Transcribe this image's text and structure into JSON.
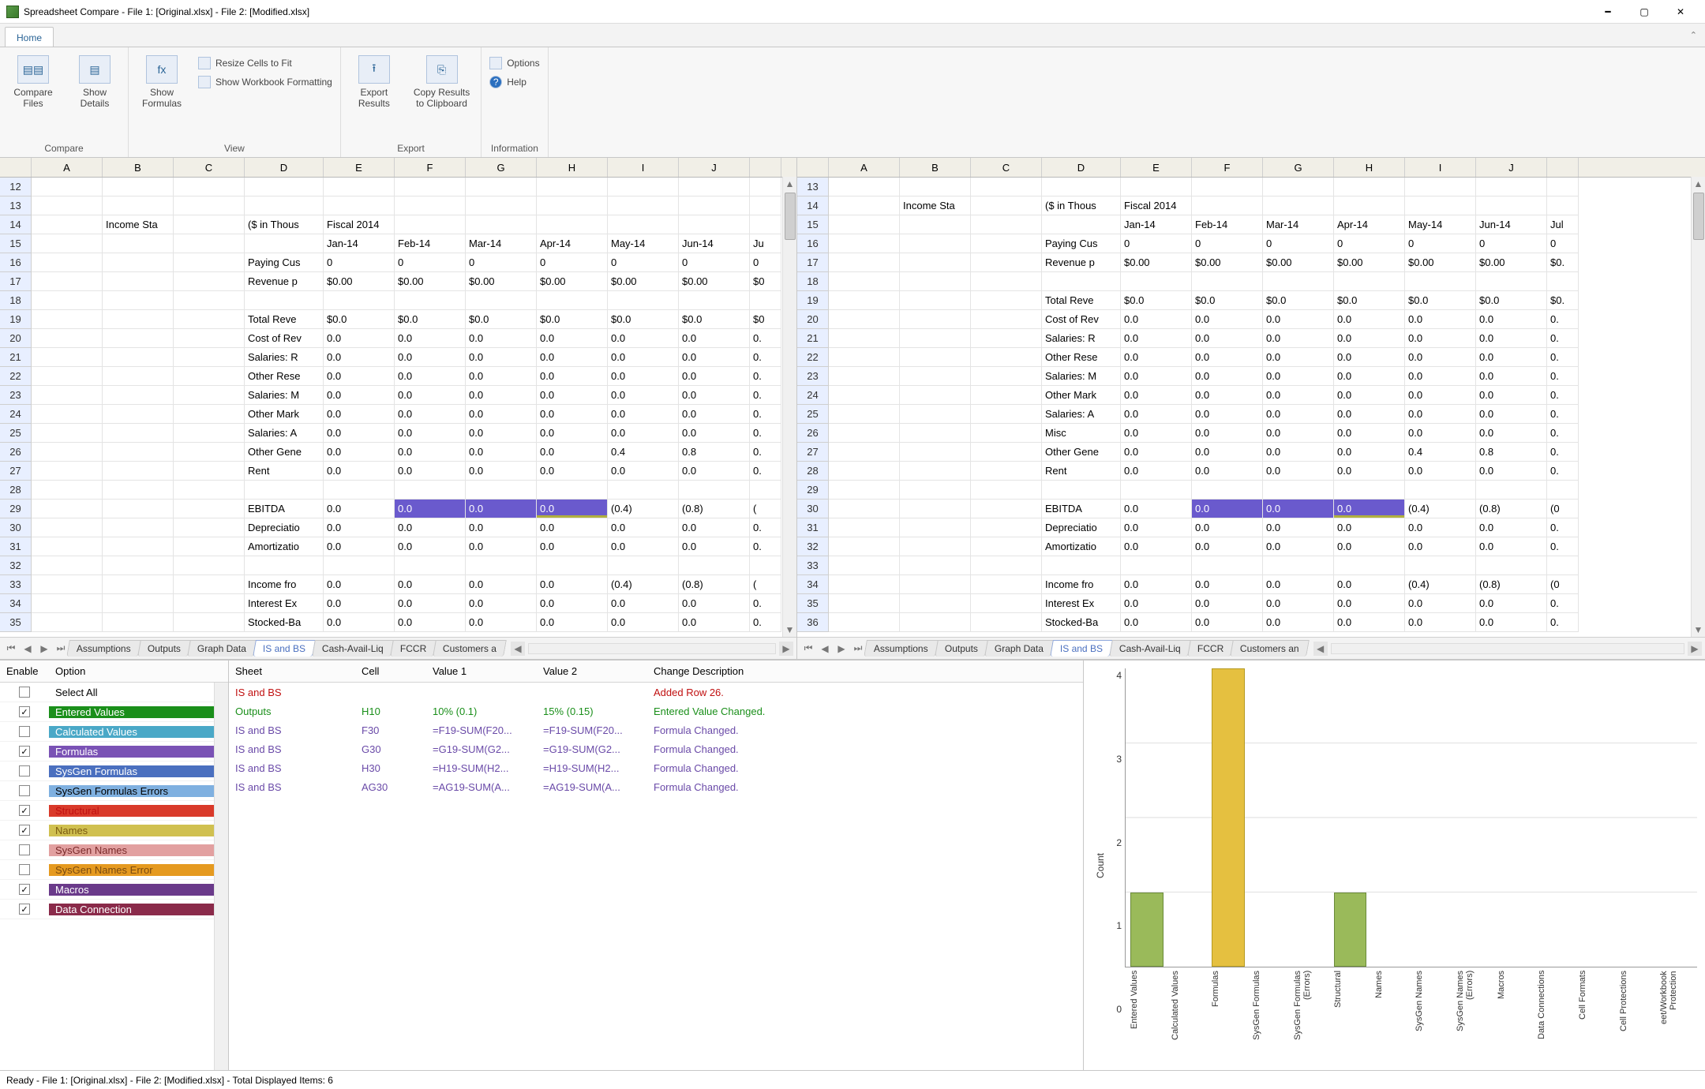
{
  "window": {
    "title": "Spreadsheet Compare - File 1: [Original.xlsx] - File 2: [Modified.xlsx]"
  },
  "tab": {
    "home": "Home"
  },
  "ribbon": {
    "compare": {
      "compareFiles": "Compare\nFiles",
      "showDetails": "Show\nDetails",
      "group": "Compare"
    },
    "view": {
      "showFormulas": "Show\nFormulas",
      "resize": "Resize Cells to Fit",
      "showWb": "Show Workbook Formatting",
      "group": "View"
    },
    "export": {
      "exportResults": "Export\nResults",
      "copyResults": "Copy Results\nto Clipboard",
      "group": "Export"
    },
    "info": {
      "options": "Options",
      "help": "Help",
      "group": "Information"
    }
  },
  "grid": {
    "cols": [
      "A",
      "B",
      "C",
      "D",
      "E",
      "F",
      "G",
      "H",
      "I",
      "J"
    ],
    "colsR": [
      "A",
      "B",
      "C",
      "D",
      "E",
      "F",
      "G",
      "H",
      "I",
      "J"
    ],
    "rowsLeft": [
      12,
      13,
      14,
      15,
      16,
      17,
      18,
      19,
      20,
      21,
      22,
      23,
      24,
      25,
      26,
      27,
      28,
      29,
      30,
      31,
      32,
      33,
      34,
      35
    ],
    "rowsRight": [
      13,
      14,
      15,
      16,
      17,
      18,
      19,
      20,
      21,
      22,
      23,
      24,
      25,
      26,
      27,
      28,
      29,
      30,
      31,
      32,
      33,
      34,
      35,
      36
    ],
    "left": {
      "14": {
        "B": "Income Sta",
        "D": "($ in Thous",
        "E": "Fiscal 2014"
      },
      "15": {
        "E": "Jan-14",
        "F": "Feb-14",
        "G": "Mar-14",
        "H": "Apr-14",
        "I": "May-14",
        "J": "Jun-14",
        "K": "Ju"
      },
      "16": {
        "D": "Paying Cus",
        "E": "0",
        "F": "0",
        "G": "0",
        "H": "0",
        "I": "0",
        "J": "0",
        "K": "0"
      },
      "17": {
        "D": "Revenue p",
        "E": "$0.00",
        "F": "$0.00",
        "G": "$0.00",
        "H": "$0.00",
        "I": "$0.00",
        "J": "$0.00",
        "K": "$0"
      },
      "19": {
        "D": "Total Reve",
        "E": "$0.0",
        "F": "$0.0",
        "G": "$0.0",
        "H": "$0.0",
        "I": "$0.0",
        "J": "$0.0",
        "K": "$0"
      },
      "20": {
        "D": "Cost of Rev",
        "E": "0.0",
        "F": "0.0",
        "G": "0.0",
        "H": "0.0",
        "I": "0.0",
        "J": "0.0",
        "K": "0."
      },
      "21": {
        "D": "Salaries: R",
        "E": "0.0",
        "F": "0.0",
        "G": "0.0",
        "H": "0.0",
        "I": "0.0",
        "J": "0.0",
        "K": "0."
      },
      "22": {
        "D": "Other Rese",
        "E": "0.0",
        "F": "0.0",
        "G": "0.0",
        "H": "0.0",
        "I": "0.0",
        "J": "0.0",
        "K": "0."
      },
      "23": {
        "D": "Salaries: M",
        "E": "0.0",
        "F": "0.0",
        "G": "0.0",
        "H": "0.0",
        "I": "0.0",
        "J": "0.0",
        "K": "0."
      },
      "24": {
        "D": "Other Mark",
        "E": "0.0",
        "F": "0.0",
        "G": "0.0",
        "H": "0.0",
        "I": "0.0",
        "J": "0.0",
        "K": "0."
      },
      "25": {
        "D": "Salaries: A",
        "E": "0.0",
        "F": "0.0",
        "G": "0.0",
        "H": "0.0",
        "I": "0.0",
        "J": "0.0",
        "K": "0."
      },
      "26": {
        "D": "Other Gene",
        "E": "0.0",
        "F": "0.0",
        "G": "0.0",
        "H": "0.0",
        "I": "0.4",
        "J": "0.8",
        "K": "0."
      },
      "27": {
        "D": "Rent",
        "E": "0.0",
        "F": "0.0",
        "G": "0.0",
        "H": "0.0",
        "I": "0.0",
        "J": "0.0",
        "K": "0."
      },
      "29": {
        "D": "EBITDA",
        "E": "0.0",
        "F": "0.0",
        "G": "0.0",
        "H": "0.0",
        "I": "(0.4)",
        "J": "(0.8)",
        "K": "("
      },
      "30": {
        "D": "Depreciatio",
        "E": "0.0",
        "F": "0.0",
        "G": "0.0",
        "H": "0.0",
        "I": "0.0",
        "J": "0.0",
        "K": "0."
      },
      "31": {
        "D": "Amortizatio",
        "E": "0.0",
        "F": "0.0",
        "G": "0.0",
        "H": "0.0",
        "I": "0.0",
        "J": "0.0",
        "K": "0."
      },
      "33": {
        "D": "Income fro",
        "E": "0.0",
        "F": "0.0",
        "G": "0.0",
        "H": "0.0",
        "I": "(0.4)",
        "J": "(0.8)",
        "K": "("
      },
      "34": {
        "D": "Interest Ex",
        "E": "0.0",
        "F": "0.0",
        "G": "0.0",
        "H": "0.0",
        "I": "0.0",
        "J": "0.0",
        "K": "0."
      },
      "35": {
        "D": "Stocked-Ba",
        "E": "0.0",
        "F": "0.0",
        "G": "0.0",
        "H": "0.0",
        "I": "0.0",
        "J": "0.0",
        "K": "0."
      }
    },
    "right": {
      "14": {
        "B": "Income Sta",
        "D": "($ in Thous",
        "E": "Fiscal 2014"
      },
      "15": {
        "E": "Jan-14",
        "F": "Feb-14",
        "G": "Mar-14",
        "H": "Apr-14",
        "I": "May-14",
        "J": "Jun-14",
        "K": "Jul"
      },
      "16": {
        "D": "Paying Cus",
        "E": "0",
        "F": "0",
        "G": "0",
        "H": "0",
        "I": "0",
        "J": "0",
        "K": "0"
      },
      "17": {
        "D": "Revenue p",
        "E": "$0.00",
        "F": "$0.00",
        "G": "$0.00",
        "H": "$0.00",
        "I": "$0.00",
        "J": "$0.00",
        "K": "$0."
      },
      "19": {
        "D": "Total Reve",
        "E": "$0.0",
        "F": "$0.0",
        "G": "$0.0",
        "H": "$0.0",
        "I": "$0.0",
        "J": "$0.0",
        "K": "$0."
      },
      "20": {
        "D": "Cost of Rev",
        "E": "0.0",
        "F": "0.0",
        "G": "0.0",
        "H": "0.0",
        "I": "0.0",
        "J": "0.0",
        "K": "0."
      },
      "21": {
        "D": "Salaries: R",
        "E": "0.0",
        "F": "0.0",
        "G": "0.0",
        "H": "0.0",
        "I": "0.0",
        "J": "0.0",
        "K": "0."
      },
      "22": {
        "D": "Other Rese",
        "E": "0.0",
        "F": "0.0",
        "G": "0.0",
        "H": "0.0",
        "I": "0.0",
        "J": "0.0",
        "K": "0."
      },
      "23": {
        "D": "Salaries: M",
        "E": "0.0",
        "F": "0.0",
        "G": "0.0",
        "H": "0.0",
        "I": "0.0",
        "J": "0.0",
        "K": "0."
      },
      "24": {
        "D": "Other Mark",
        "E": "0.0",
        "F": "0.0",
        "G": "0.0",
        "H": "0.0",
        "I": "0.0",
        "J": "0.0",
        "K": "0."
      },
      "25": {
        "D": "Salaries: A",
        "E": "0.0",
        "F": "0.0",
        "G": "0.0",
        "H": "0.0",
        "I": "0.0",
        "J": "0.0",
        "K": "0."
      },
      "26": {
        "D": "Misc",
        "E": "0.0",
        "F": "0.0",
        "G": "0.0",
        "H": "0.0",
        "I": "0.0",
        "J": "0.0",
        "K": "0."
      },
      "27": {
        "D": "Other Gene",
        "E": "0.0",
        "F": "0.0",
        "G": "0.0",
        "H": "0.0",
        "I": "0.4",
        "J": "0.8",
        "K": "0."
      },
      "28": {
        "D": "Rent",
        "E": "0.0",
        "F": "0.0",
        "G": "0.0",
        "H": "0.0",
        "I": "0.0",
        "J": "0.0",
        "K": "0."
      },
      "30": {
        "D": "EBITDA",
        "E": "0.0",
        "F": "0.0",
        "G": "0.0",
        "H": "0.0",
        "I": "(0.4)",
        "J": "(0.8)",
        "K": "(0"
      },
      "31": {
        "D": "Depreciatio",
        "E": "0.0",
        "F": "0.0",
        "G": "0.0",
        "H": "0.0",
        "I": "0.0",
        "J": "0.0",
        "K": "0."
      },
      "32": {
        "D": "Amortizatio",
        "E": "0.0",
        "F": "0.0",
        "G": "0.0",
        "H": "0.0",
        "I": "0.0",
        "J": "0.0",
        "K": "0."
      },
      "34": {
        "D": "Income fro",
        "E": "0.0",
        "F": "0.0",
        "G": "0.0",
        "H": "0.0",
        "I": "(0.4)",
        "J": "(0.8)",
        "K": "(0"
      },
      "35": {
        "D": "Interest Ex",
        "E": "0.0",
        "F": "0.0",
        "G": "0.0",
        "H": "0.0",
        "I": "0.0",
        "J": "0.0",
        "K": "0."
      },
      "36": {
        "D": "Stocked-Ba",
        "E": "0.0",
        "F": "0.0",
        "G": "0.0",
        "H": "0.0",
        "I": "0.0",
        "J": "0.0",
        "K": "0."
      }
    },
    "hlLeft": {
      "row": 29,
      "cols": [
        "F",
        "G",
        "H"
      ]
    },
    "hlRight": {
      "row": 30,
      "cols": [
        "F",
        "G",
        "H"
      ]
    }
  },
  "sheets": [
    "Assumptions",
    "Outputs",
    "Graph Data",
    "IS and BS",
    "Cash-Avail-Liq",
    "FCCR",
    "Customers a"
  ],
  "sheetsRight": [
    "Assumptions",
    "Outputs",
    "Graph Data",
    "IS and BS",
    "Cash-Avail-Liq",
    "FCCR",
    "Customers an"
  ],
  "activeSheet": "IS and BS",
  "options": {
    "hdrEnable": "Enable",
    "hdrOption": "Option",
    "rows": [
      {
        "label": "Select All",
        "checked": false,
        "bg": "#ffffff",
        "fg": "#000"
      },
      {
        "label": "Entered Values",
        "checked": true,
        "bg": "#1a8f1a",
        "fg": "#fff"
      },
      {
        "label": "Calculated Values",
        "checked": false,
        "bg": "#4aa8c7",
        "fg": "#fff"
      },
      {
        "label": "Formulas",
        "checked": true,
        "bg": "#7a52b5",
        "fg": "#fff"
      },
      {
        "label": "SysGen Formulas",
        "checked": false,
        "bg": "#4a6fbf",
        "fg": "#fff"
      },
      {
        "label": "SysGen Formulas Errors",
        "checked": false,
        "bg": "#7fb0e0",
        "fg": "#000"
      },
      {
        "label": "Structural",
        "checked": true,
        "bg": "#d93a2a",
        "fg": "#c01010"
      },
      {
        "label": "Names",
        "checked": true,
        "bg": "#d0c050",
        "fg": "#7a5a10"
      },
      {
        "label": "SysGen Names",
        "checked": false,
        "bg": "#e2a0a0",
        "fg": "#7a2a2a"
      },
      {
        "label": "SysGen Names Error",
        "checked": false,
        "bg": "#e59a20",
        "fg": "#7a4a10"
      },
      {
        "label": "Macros",
        "checked": true,
        "bg": "#6a3a8a",
        "fg": "#fff"
      },
      {
        "label": "Data Connection",
        "checked": true,
        "bg": "#8a2a4a",
        "fg": "#fff"
      }
    ]
  },
  "diff": {
    "headers": {
      "sheet": "Sheet",
      "cell": "Cell",
      "v1": "Value 1",
      "v2": "Value 2",
      "desc": "Change Description"
    },
    "rows": [
      {
        "sheet": "IS and BS",
        "cell": "",
        "v1": "",
        "v2": "",
        "desc": "Added Row 26.",
        "color": "#c01010"
      },
      {
        "sheet": "Outputs",
        "cell": "H10",
        "v1": "10% (0.1)",
        "v2": "15% (0.15)",
        "desc": "Entered Value Changed.",
        "color": "#1a8f1a"
      },
      {
        "sheet": "IS and BS",
        "cell": "F30",
        "v1": "=F19-SUM(F20...",
        "v2": "=F19-SUM(F20...",
        "desc": "Formula Changed.",
        "color": "#6a4aa8"
      },
      {
        "sheet": "IS and BS",
        "cell": "G30",
        "v1": "=G19-SUM(G2...",
        "v2": "=G19-SUM(G2...",
        "desc": "Formula Changed.",
        "color": "#6a4aa8"
      },
      {
        "sheet": "IS and BS",
        "cell": "H30",
        "v1": "=H19-SUM(H2...",
        "v2": "=H19-SUM(H2...",
        "desc": "Formula Changed.",
        "color": "#6a4aa8"
      },
      {
        "sheet": "IS and BS",
        "cell": "AG30",
        "v1": "=AG19-SUM(A...",
        "v2": "=AG19-SUM(A...",
        "desc": "Formula Changed.",
        "color": "#6a4aa8"
      }
    ]
  },
  "chart_data": {
    "type": "bar",
    "ylabel": "Count",
    "categories": [
      "Entered Values",
      "Calculated Values",
      "Formulas",
      "SysGen Formulas",
      "SysGen Formulas (Errors)",
      "Structural",
      "Names",
      "SysGen Names",
      "SysGen Names (Errors)",
      "Macros",
      "Data Connections",
      "Cell Formats",
      "Cell Protections",
      "eet/Workbook Protection"
    ],
    "values": [
      1,
      0,
      4,
      0,
      0,
      1,
      0,
      0,
      0,
      0,
      0,
      0,
      0,
      0
    ],
    "colors": [
      "#9aba5a",
      "#9aba5a",
      "#e5c040",
      "#9aba5a",
      "#9aba5a",
      "#9aba5a",
      "#9aba5a",
      "#9aba5a",
      "#9aba5a",
      "#9aba5a",
      "#9aba5a",
      "#9aba5a",
      "#9aba5a",
      "#9aba5a"
    ],
    "ymax": 4,
    "yticks": [
      0,
      1,
      2,
      3,
      4
    ]
  },
  "status": "Ready - File 1: [Original.xlsx] - File 2: [Modified.xlsx] - Total Displayed Items: 6"
}
